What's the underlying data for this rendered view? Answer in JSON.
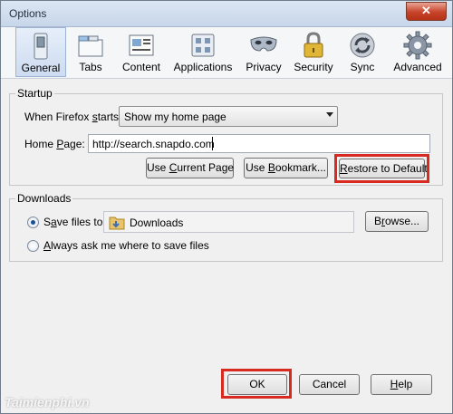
{
  "window": {
    "title": "Options",
    "close_glyph": "✕"
  },
  "toolbar": {
    "panes": [
      {
        "label": "General",
        "icon": "switch-icon"
      },
      {
        "label": "Tabs",
        "icon": "tabs-icon"
      },
      {
        "label": "Content",
        "icon": "content-icon"
      },
      {
        "label": "Applications",
        "icon": "applications-icon"
      },
      {
        "label": "Privacy",
        "icon": "privacy-mask-icon"
      },
      {
        "label": "Security",
        "icon": "padlock-icon"
      },
      {
        "label": "Sync",
        "icon": "sync-icon"
      },
      {
        "label": "Advanced",
        "icon": "gear-icon"
      }
    ],
    "selected": "General"
  },
  "startup": {
    "title": "Startup",
    "when_label_pre": "When Firefox ",
    "when_label_accel": "s",
    "when_label_post": "tarts:",
    "when_value": "Show my home page",
    "home_label_pre": "Home ",
    "home_label_accel": "P",
    "home_label_post": "age:",
    "home_value": "http://search.snapdo.com",
    "btn_current_pre": "Use ",
    "btn_current_accel": "C",
    "btn_current_post": "urrent Page",
    "btn_bookmark_pre": "Use ",
    "btn_bookmark_accel": "B",
    "btn_bookmark_post": "ookmark...",
    "btn_restore_accel": "R",
    "btn_restore_post": "estore to Default"
  },
  "downloads": {
    "title": "Downloads",
    "save_pre": "S",
    "save_accel": "a",
    "save_post": "ve files to",
    "folder": "Downloads",
    "browse_pre": "B",
    "browse_accel": "r",
    "browse_post": "owse...",
    "ask_accel": "A",
    "ask_post": "lways ask me where to save files",
    "save_selected": true
  },
  "footer": {
    "ok": "OK",
    "cancel": "Cancel",
    "help_accel": "H",
    "help_post": "elp"
  },
  "watermark": "Taimienphi.vn",
  "colors": {
    "highlight": "#d92a22",
    "selected_pane": "#cddcf1",
    "titlebar": "#c7d6ea"
  }
}
